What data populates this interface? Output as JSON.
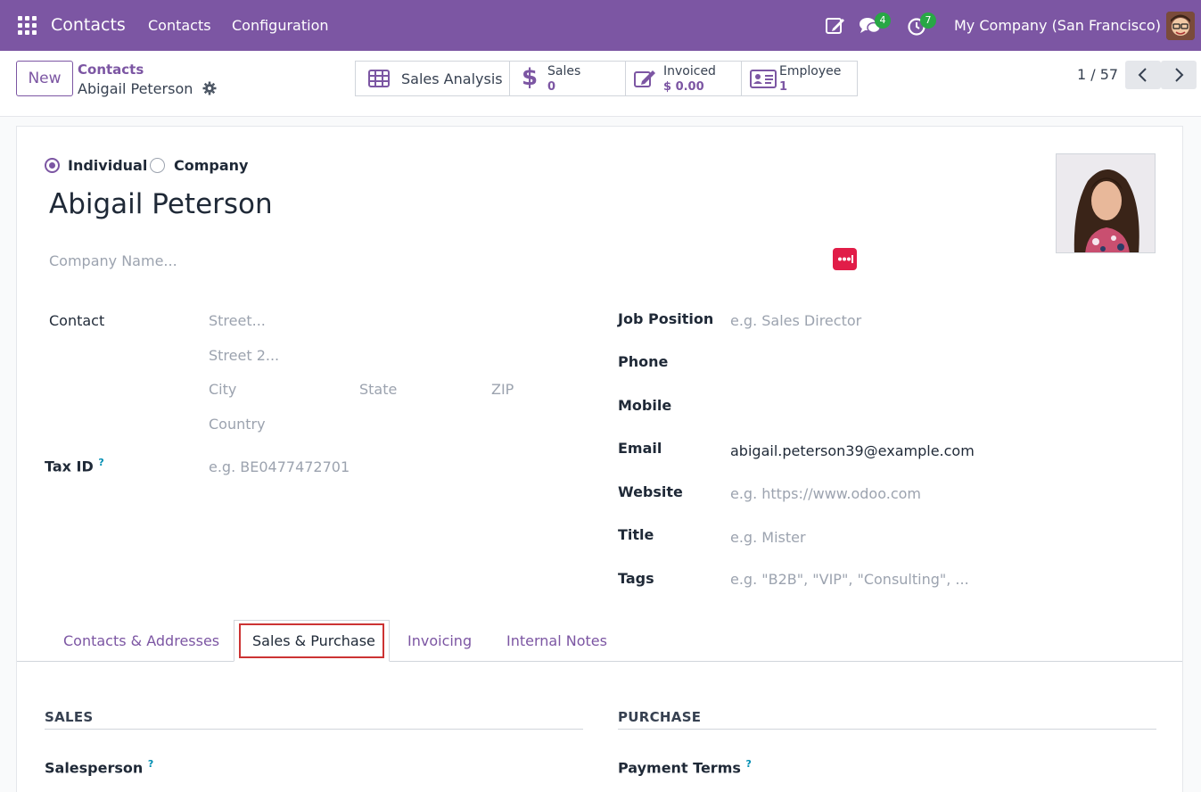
{
  "topnav": {
    "brand": "Contacts",
    "menu": [
      "Contacts",
      "Configuration"
    ],
    "messages_count": "4",
    "activities_count": "7",
    "company": "My Company (San Francisco)"
  },
  "cpanel": {
    "new_label": "New",
    "breadcrumb_parent": "Contacts",
    "breadcrumb_current": "Abigail Peterson",
    "smart_buttons": {
      "analysis": "Sales Analysis",
      "sales_label": "Sales",
      "sales_value": "0",
      "invoiced_label": "Invoiced",
      "invoiced_value": "$ 0.00",
      "employee_label": "Employee",
      "employee_value": "1"
    },
    "pager": "1 / 57"
  },
  "form": {
    "type_individual": "Individual",
    "type_company": "Company",
    "name": "Abigail Peterson",
    "company_placeholder": "Company Name...",
    "contact_label": "Contact",
    "street_placeholder": "Street...",
    "street2_placeholder": "Street 2...",
    "city_placeholder": "City",
    "state_placeholder": "State",
    "zip_placeholder": "ZIP",
    "country_placeholder": "Country",
    "taxid_label": "Tax ID",
    "taxid_placeholder": "e.g. BE0477472701",
    "job_label": "Job Position",
    "job_placeholder": "e.g. Sales Director",
    "phone_label": "Phone",
    "mobile_label": "Mobile",
    "email_label": "Email",
    "email_value": "abigail.peterson39@example.com",
    "website_label": "Website",
    "website_placeholder": "e.g. https://www.odoo.com",
    "title_label": "Title",
    "title_placeholder": "e.g. Mister",
    "tags_label": "Tags",
    "tags_placeholder": "e.g. \"B2B\", \"VIP\", \"Consulting\", ...",
    "help_mark": "?"
  },
  "tabs": [
    "Contacts & Addresses",
    "Sales & Purchase",
    "Invoicing",
    "Internal Notes"
  ],
  "sales_section": {
    "title": "SALES",
    "salesperson_label": "Salesperson"
  },
  "purchase_section": {
    "title": "PURCHASE",
    "payment_terms_label": "Payment Terms"
  },
  "colors": {
    "brand": "#7c56a3",
    "badge": "#28a745",
    "active_tab_outline": "#cc3333"
  }
}
